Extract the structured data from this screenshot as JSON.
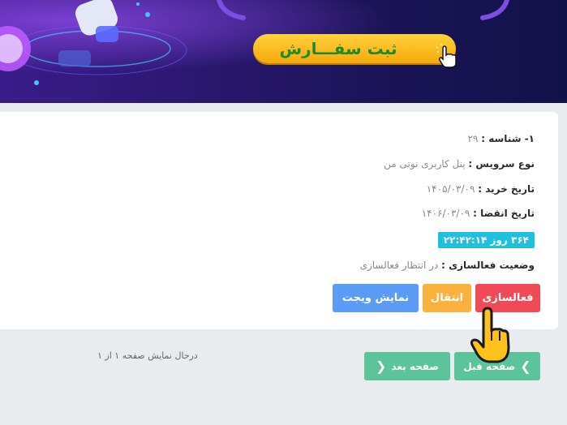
{
  "banner": {
    "order_button_label": "ثبت سفـــارش"
  },
  "service": {
    "id_label": "۱- شناسه :",
    "id_value": "۲۹",
    "type_label": "نوع سرویس :",
    "type_value": "پنل کاربری نوتی من",
    "purchase_label": "تاریخ خرید :",
    "purchase_value": "۱۴۰۵/۰۳/۰۹",
    "expire_label": "تاریخ انقضا :",
    "expire_value": "۱۴۰۶/۰۳/۰۹",
    "remaining_badge": "۳۶۴ روز ۲۲:۴۲:۱۴",
    "activation_label": "وضعیت فعالسازی :",
    "activation_value": "در انتظار فعالسازی"
  },
  "actions": {
    "activate": "فعالسازی",
    "transfer": "انتقال",
    "widget": "نمایش ویجت"
  },
  "pagination": {
    "prev": "صفحه قبل",
    "next": "صفحه بعد",
    "status": "درحال نمایش صفحه ۱ از ۱"
  },
  "colors": {
    "red": "#ef4a55",
    "yellow": "#fbb13b",
    "blue": "#5b9bf5",
    "green": "#5cc39a",
    "cyan": "#1fbfe0"
  }
}
